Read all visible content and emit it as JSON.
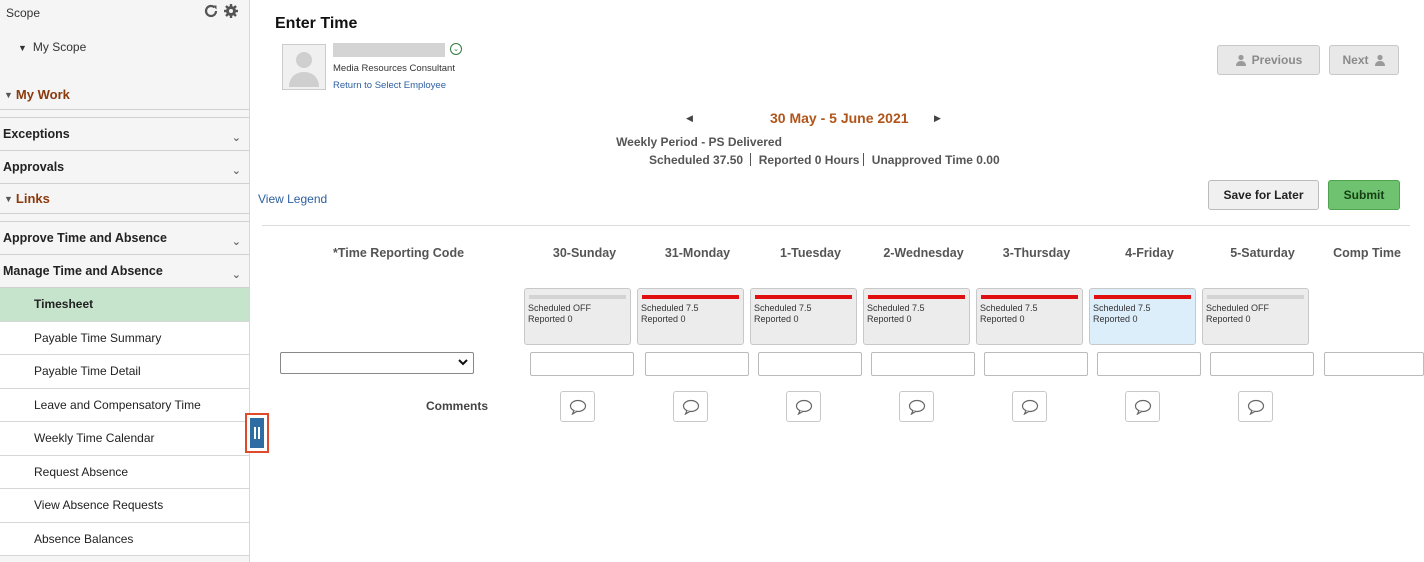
{
  "sidebar": {
    "scope_label": "Scope",
    "scope_item": "My Scope",
    "my_work_label": "My Work",
    "exceptions_label": "Exceptions",
    "approvals_label": "Approvals",
    "links_label": "Links",
    "approve_label": "Approve Time and Absence",
    "manage_label": "Manage Time and Absence",
    "items": [
      {
        "label": "Timesheet"
      },
      {
        "label": "Payable Time Summary"
      },
      {
        "label": "Payable Time Detail"
      },
      {
        "label": "Leave and Compensatory Time"
      },
      {
        "label": "Weekly Time Calendar"
      },
      {
        "label": "Request Absence"
      },
      {
        "label": "View Absence Requests"
      },
      {
        "label": "Absence Balances"
      }
    ]
  },
  "page": {
    "title": "Enter Time"
  },
  "employee": {
    "role": "Media Resources Consultant",
    "return_link": "Return to Select Employee"
  },
  "header_buttons": {
    "previous": "Previous",
    "next": "Next"
  },
  "period": {
    "range": "30 May - 5 June 2021",
    "type": "Weekly Period - PS Delivered",
    "scheduled_label": "Scheduled",
    "scheduled_value": "37.50",
    "reported_label": "Reported",
    "reported_value": "0 Hours",
    "unapproved_label": "Unapproved Time",
    "unapproved_value": "0.00"
  },
  "actions": {
    "view_legend": "View Legend",
    "save_for_later": "Save for Later",
    "submit": "Submit"
  },
  "grid": {
    "trc_header": "*Time Reporting Code",
    "comp_header": "Comp Time",
    "comments_label": "Comments",
    "days": [
      {
        "label": "30-Sunday",
        "scheduled": "Scheduled OFF",
        "reported": "Reported  0"
      },
      {
        "label": "31-Monday",
        "scheduled": "Scheduled 7.5",
        "reported": "Reported  0"
      },
      {
        "label": "1-Tuesday",
        "scheduled": "Scheduled 7.5",
        "reported": "Reported  0"
      },
      {
        "label": "2-Wednesday",
        "scheduled": "Scheduled 7.5",
        "reported": "Reported  0"
      },
      {
        "label": "3-Thursday",
        "scheduled": "Scheduled 7.5",
        "reported": "Reported  0"
      },
      {
        "label": "4-Friday",
        "scheduled": "Scheduled 7.5",
        "reported": "Reported  0"
      },
      {
        "label": "5-Saturday",
        "scheduled": "Scheduled OFF",
        "reported": "Reported  0"
      }
    ]
  },
  "colors": {
    "accent_green": "#c6e4cc",
    "submit_green": "#6fc26f",
    "link_blue": "#2d5fa0",
    "period_orange": "#b0551a",
    "schedule_red": "#e01010"
  },
  "icons": {
    "refresh": "refresh-icon",
    "gear": "gear-icon",
    "user": "user-icon",
    "comment": "comment-icon",
    "pause": "pause-icon"
  }
}
